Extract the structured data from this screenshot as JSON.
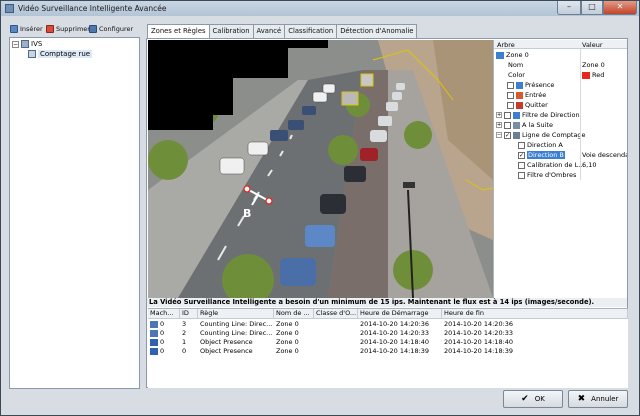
{
  "window": {
    "title": "Vidéo Surveillance Intelligente Avancée"
  },
  "toolbar": {
    "insert": "Insérer",
    "delete": "Supprimer",
    "configure": "Configurer"
  },
  "tree": {
    "root": "IVS",
    "child": "Comptage rue"
  },
  "tabs": [
    "Zones et Règles",
    "Calibration",
    "Avancé",
    "Classification",
    "Détection d'Anomalie"
  ],
  "props": {
    "col_tree": "Arbre",
    "col_value": "Valeur",
    "rows": [
      {
        "label": "Zone 0",
        "value": ""
      },
      {
        "label": "Nom",
        "value": "Zone 0"
      },
      {
        "label": "Color",
        "value": "Red"
      },
      {
        "label": "Présence",
        "value": ""
      },
      {
        "label": "Entrée",
        "value": ""
      },
      {
        "label": "Quitter",
        "value": ""
      },
      {
        "label": "Filtre de Direction",
        "value": ""
      },
      {
        "label": "A la Suite",
        "value": ""
      },
      {
        "label": "Ligne de Comptage",
        "value": ""
      },
      {
        "label": "Direction A",
        "value": ""
      },
      {
        "label": "Direction B",
        "value": "Voie descendan"
      },
      {
        "label": "Calibration de L...",
        "value": "6,10"
      },
      {
        "label": "Filtre d'Ombres",
        "value": ""
      }
    ]
  },
  "video": {
    "line_label": "B"
  },
  "warning": "La Vidéo Surveillance  Intelligente a besoin d'un minimum de 15 ips. Maintenant le flux est à 14 ips (images/seconde).",
  "events": {
    "headers": [
      "Mach...",
      "ID",
      "Règle",
      "Nom de ...",
      "Classe d'O...",
      "Heure de Démarrage",
      "Heure de fin"
    ],
    "rows": [
      [
        "0",
        "3",
        "Counting Line: Direc...",
        "Zone 0",
        "",
        "2014-10-20 14:20:36",
        "2014-10-20 14:20:36"
      ],
      [
        "0",
        "2",
        "Counting Line: Direc...",
        "Zone 0",
        "",
        "2014-10-20 14:20:33",
        "2014-10-20 14:20:33"
      ],
      [
        "0",
        "1",
        "Object Presence",
        "Zone 0",
        "",
        "2014-10-20 14:18:40",
        "2014-10-20 14:18:40"
      ],
      [
        "0",
        "0",
        "Object Presence",
        "Zone 0",
        "",
        "2014-10-20 14:18:39",
        "2014-10-20 14:18:39"
      ]
    ]
  },
  "buttons": {
    "ok": "OK",
    "cancel": "Annuler"
  },
  "colors": {
    "zone": "#e8261b",
    "title_bar": "#b9c9d9"
  }
}
